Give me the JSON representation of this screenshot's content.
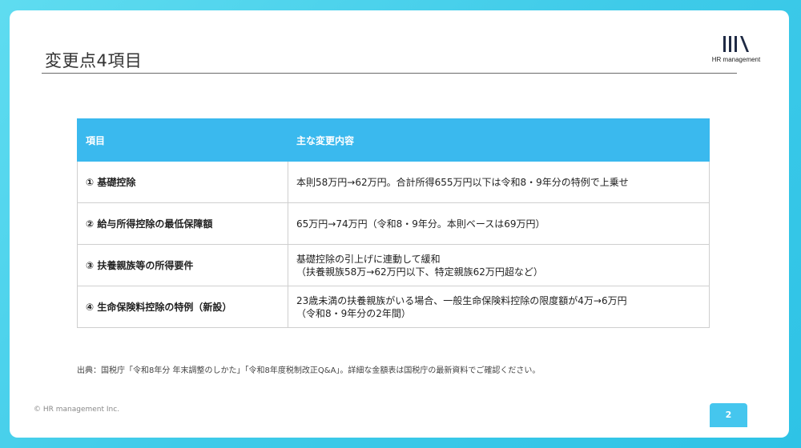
{
  "slide": {
    "title": "変更点4項目",
    "logo_text": "HR management",
    "note": "出典：国税庁「令和8年分 年末調整のしかた」「令和8年度税制改正Q&A」。詳細な金額表は国税庁の最新資料でご確認ください。",
    "copyright": "© HR management Inc.",
    "page_number": "2"
  },
  "table": {
    "headers": [
      "項目",
      "主な変更内容"
    ],
    "rows": [
      {
        "item": "① 基礎控除",
        "line1": "本則58万円→62万円。合計所得655万円以下は令和8・9年分の特例で上乗せ",
        "line2": ""
      },
      {
        "item": "② 給与所得控除の最低保障額",
        "line1": "65万円→74万円（令和8・9年分。本則ベースは69万円）",
        "line2": ""
      },
      {
        "item": "③ 扶養親族等の所得要件",
        "line1": "基礎控除の引上げに連動して緩和",
        "line2": "（扶養親族58万→62万円以下、特定親族62万円超など）"
      },
      {
        "item": "④ 生命保険料控除の特例（新設）",
        "line1": "23歳未満の扶養親族がいる場合、一般生命保険料控除の限度額が4万→6万円",
        "line2": "（令和8・9年分の2年間）"
      }
    ]
  },
  "colors": {
    "background": "#3fcbe9",
    "header_fill": "#3ab9ee",
    "page_badge": "#45c6ee"
  },
  "icons": {
    "logo": "hr-management-logo"
  }
}
